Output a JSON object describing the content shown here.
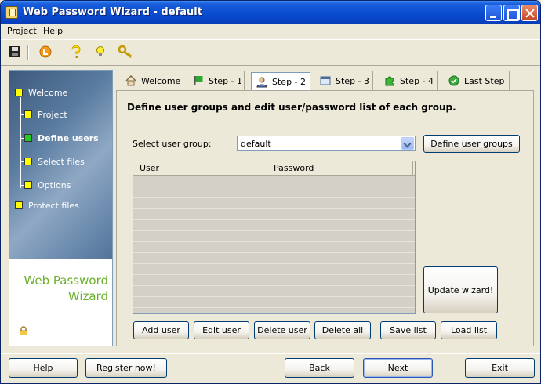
{
  "window": {
    "title": "Web Password Wizard - default"
  },
  "menu": [
    "Project",
    "Help"
  ],
  "toolbar": {
    "icons": [
      "save-icon",
      "l-circle-icon",
      "question-icon",
      "tip-bulb-icon",
      "key-icon"
    ]
  },
  "sidebar": {
    "items": [
      {
        "label": "Welcome"
      },
      {
        "label": "Project"
      },
      {
        "label": "Define users",
        "active": true
      },
      {
        "label": "Select files"
      },
      {
        "label": "Options"
      },
      {
        "label": "Protect files"
      }
    ],
    "brand_line1": "Web Password",
    "brand_line2": "Wizard"
  },
  "tabs": [
    {
      "label": "Welcome",
      "icon": "home-icon"
    },
    {
      "label": "Step - 1",
      "icon": "flag-icon"
    },
    {
      "label": "Step - 2",
      "icon": "user-icon",
      "active": true
    },
    {
      "label": "Step - 3",
      "icon": "window-icon"
    },
    {
      "label": "Step - 4",
      "icon": "puzzle-icon"
    },
    {
      "label": "Last Step",
      "icon": "check-icon"
    }
  ],
  "main": {
    "heading": "Define user groups and edit user/password list of each group.",
    "group_label": "Select user group:",
    "group_value": "default",
    "define_groups_button": "Define user groups",
    "columns": [
      "User",
      "Password"
    ],
    "update_button": "Update wizard!",
    "actions": [
      "Add user",
      "Edit user",
      "Delete user",
      "Delete all",
      "Save list",
      "Load list"
    ]
  },
  "footer": {
    "help": "Help",
    "register": "Register now!",
    "back": "Back",
    "next": "Next",
    "exit": "Exit"
  },
  "colors": {
    "titlebar": "#0a4ed0",
    "brand": "#6bb02a",
    "active_bullet": "#22cc22",
    "bullet": "#ffff00"
  }
}
